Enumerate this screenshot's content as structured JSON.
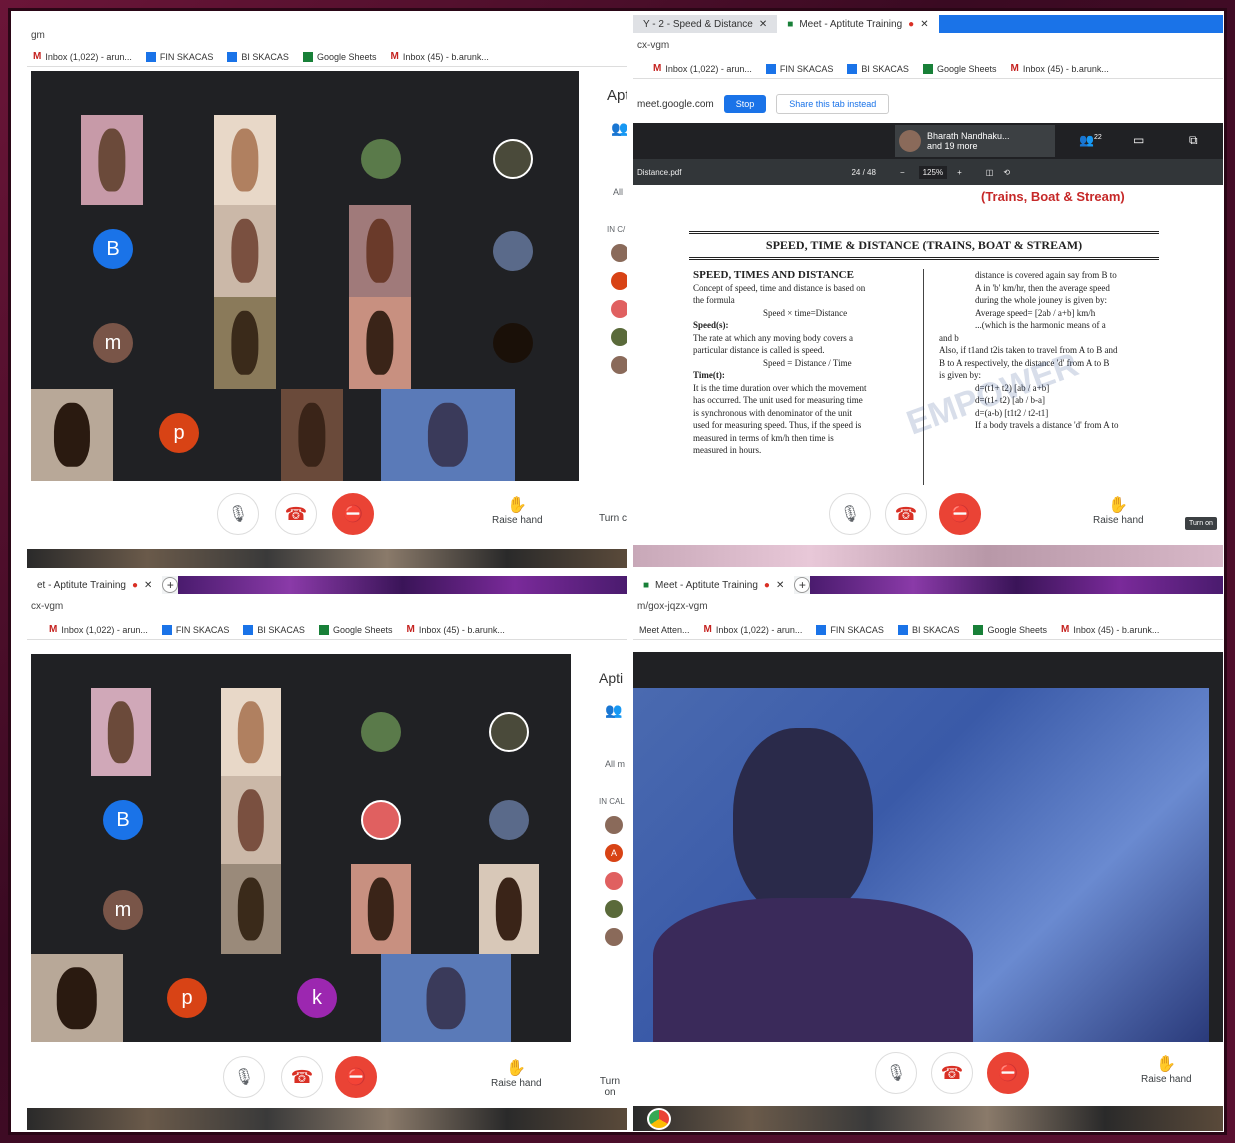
{
  "bookmarks": {
    "inbox1": "Inbox (1,022) - arun...",
    "fin": "FIN SKACAS",
    "bi": "BI SKACAS",
    "sheets": "Google Sheets",
    "inbox2": "Inbox (45) - b.arunk..."
  },
  "p1": {
    "url": "gm",
    "side_title": "Apt",
    "side_all": "All",
    "side_incall": "IN C/",
    "tiles": [
      "B",
      "m",
      "p"
    ],
    "raise": "Raise hand",
    "turn": "Turn c"
  },
  "p2": {
    "tab1": "Y - 2 - Speed & Distance",
    "tab2": "Meet - Aptitute Training",
    "url": "cx-vgm",
    "share_domain": "meet.google.com",
    "stop": "Stop",
    "share_tab": "Share this tab instead",
    "presenter_name": "Bharath Nandhaku...",
    "presenter_more": "and 19 more",
    "people_count": "22",
    "pdf_name": "Distance.pdf",
    "page": "24 / 48",
    "zoom": "125%",
    "doc_subtitle": "(Trains, Boat & Stream)",
    "doc_title": "SPEED, TIME & DISTANCE (TRAINS, BOAT & STREAM)",
    "left_heading": "SPEED, TIMES AND DISTANCE",
    "left_lines": [
      "Concept of speed, time and distance is based on",
      "the formula",
      "Speed × time=Distance",
      "Speed(s):",
      "The rate at which any moving body covers a",
      "particular distance is called is speed.",
      "Speed = Distance / Time",
      "Time(t):",
      "It is the time duration over which the movement",
      "has occurred. The unit used for measuring time",
      "is synchronous with denominator of the unit",
      "used for measuring speed. Thus, if the speed is",
      "measured in terms of km/h then time is",
      "measured in hours."
    ],
    "right_lines": [
      "distance is covered again say from B to",
      "A in 'b' km/hr, then the average speed",
      "during the whole jouney is given by:",
      "Average speed= [2ab / a+b] km/h",
      "...(which is the harmonic means of a",
      "and b",
      "Also, if t1and t2is taken to travel from A to B and",
      "B to A respectively, the distance 'd' from A to B",
      "is given by:",
      "d=(t1+ t2) [ab / a+b]",
      "d=(t1- t2) [ab / b-a]",
      "d=(a-b) [t1t2 / t2-t1]",
      "If a body travels a distance 'd' from A to"
    ],
    "watermark": "EMPOWER",
    "raise": "Raise hand",
    "turn": "Turn on"
  },
  "p3": {
    "tab": "et - Aptitute Training",
    "url": "cx-vgm",
    "side_title": "Apti",
    "side_all": "All m",
    "side_incall": "IN CAL",
    "tiles": [
      "B",
      "m",
      "p",
      "k"
    ],
    "side_a": "A",
    "raise": "Raise hand",
    "turn": "Turn on"
  },
  "p4": {
    "tab": "Meet - Aptitute Training",
    "url": "m/gox-jqzx-vgm",
    "first_bm": "Meet Atten...",
    "raise": "Raise hand"
  },
  "colors": {
    "meet_bg": "#202124",
    "hangup_red": "#ea4335",
    "avatar_blue": "#1a73e8",
    "avatar_brown": "#795548",
    "avatar_orange": "#d84315",
    "avatar_purple": "#9c27b0"
  }
}
